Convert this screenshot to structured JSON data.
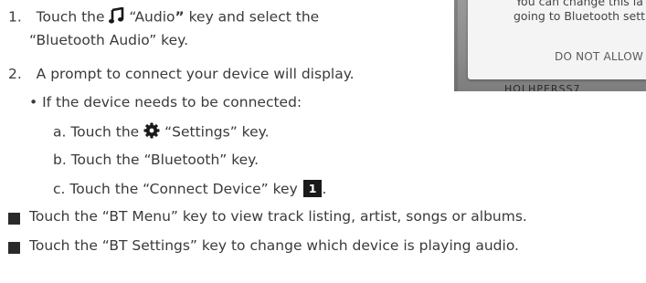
{
  "steps": [
    {
      "num": "1.",
      "pre": "Touch the",
      "key": "“Audio",
      "post_bold": "”",
      "post": " key and select the",
      "line2": "“Bluetooth Audio” key."
    },
    {
      "num": "2.",
      "text": "A prompt to connect your device will display."
    }
  ],
  "sub_bullet": "• If the device needs to be connected:",
  "sub_steps": [
    {
      "pre": "a. Touch the",
      "post": " “Settings” key."
    },
    {
      "text": "b. Touch the “Bluetooth” key."
    },
    {
      "text": "c. Touch the “Connect Device” key",
      "badge": "1",
      "tail": "."
    }
  ],
  "square_bullets": [
    "Touch the “BT Menu” key to view track listing, artist, songs or albums.",
    "Touch the “BT Settings” key to change which device is playing audio."
  ],
  "phone": {
    "dialog_line1": "You can change this la",
    "dialog_line2": "going to Bluetooth sett",
    "button": "DO NOT ALLOW",
    "under_text": "HOLHPERSS7"
  },
  "icons": {
    "audio": "music-note-icon",
    "settings": "gear-icon"
  },
  "colors": {
    "text": "#3a3a3a",
    "badge_bg": "#1a1a1a",
    "badge_fg": "#ffffff"
  }
}
